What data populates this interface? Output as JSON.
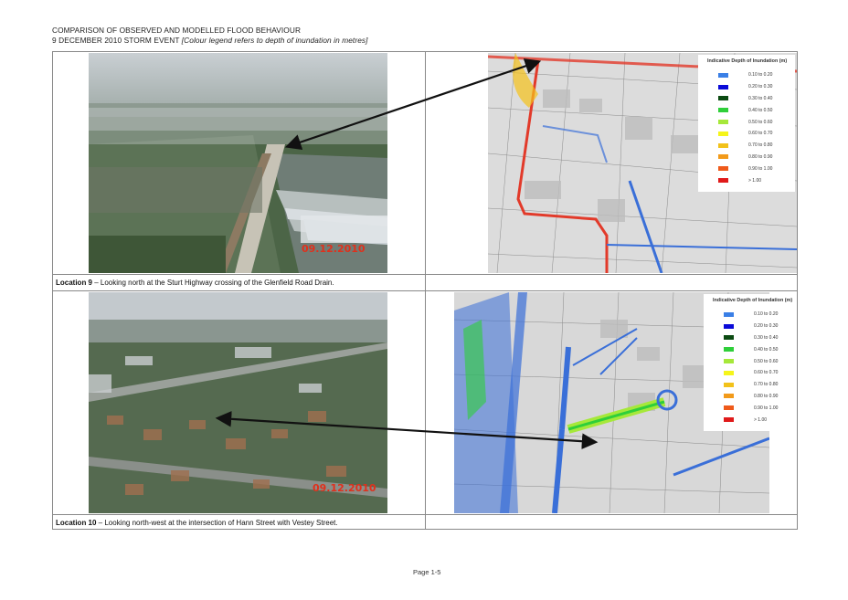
{
  "header": {
    "title": "COMPARISON OF OBSERVED AND MODELLED FLOOD BEHAVIOUR",
    "event": "9 DECEMBER 2010 STORM EVENT",
    "note": "[Colour legend refers to depth of inundation in metres]"
  },
  "locations": [
    {
      "label": "Location 9",
      "description": " – Looking north at the Sturt Highway crossing of the Glenfield Road Drain.",
      "photo_date": "09.12.2010"
    },
    {
      "label": "Location 10",
      "description": " – Looking north-west at the intersection of Hann Street with Vestey Street.",
      "photo_date": "09.12.2010"
    }
  ],
  "legend": {
    "title": "Indicative Depth of Inundation (m)",
    "items": [
      {
        "label": "0.10 to 0.20",
        "color": "#3a7fe6"
      },
      {
        "label": "0.20 to 0.30",
        "color": "#0a0ad8"
      },
      {
        "label": "0.30 to 0.40",
        "color": "#0b4a12"
      },
      {
        "label": "0.40 to 0.50",
        "color": "#2fcf3a"
      },
      {
        "label": "0.50 to 0.60",
        "color": "#a6e83a"
      },
      {
        "label": "0.60 to 0.70",
        "color": "#f5f51a"
      },
      {
        "label": "0.70 to 0.80",
        "color": "#f2c21a"
      },
      {
        "label": "0.80 to 0.90",
        "color": "#f29a1a"
      },
      {
        "label": "0.90 to 1.00",
        "color": "#ef5a1a"
      },
      {
        "label": "> 1.00",
        "color": "#e01a1a"
      }
    ]
  },
  "footer": {
    "page": "Page 1-5"
  }
}
